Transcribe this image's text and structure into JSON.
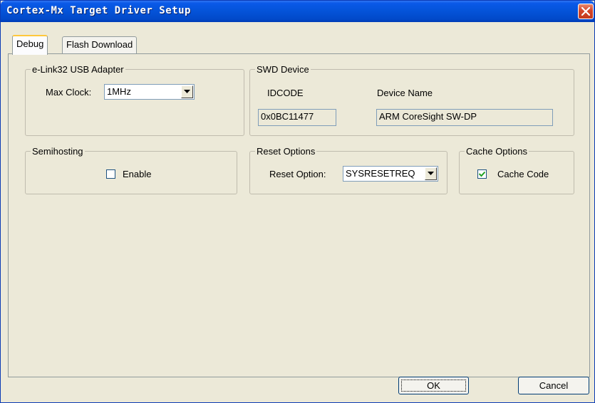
{
  "window": {
    "title": "Cortex-Mx Target Driver Setup"
  },
  "tabs": [
    {
      "label": "Debug",
      "active": true
    },
    {
      "label": "Flash Download",
      "active": false
    }
  ],
  "adapter": {
    "group_label": "e-Link32 USB Adapter",
    "max_clock_label": "Max Clock:",
    "max_clock_value": "1MHz"
  },
  "swd": {
    "group_label": "SWD Device",
    "idcode_header": "IDCODE",
    "device_name_header": "Device Name",
    "idcode_value": "0x0BC11477",
    "device_name_value": "ARM CoreSight SW-DP"
  },
  "semihosting": {
    "group_label": "Semihosting",
    "enable_label": "Enable",
    "enabled": false
  },
  "reset": {
    "group_label": "Reset Options",
    "option_label": "Reset Option:",
    "option_value": "SYSRESETREQ"
  },
  "cache": {
    "group_label": "Cache Options",
    "cache_code_label": "Cache Code",
    "cache_code_checked": true
  },
  "buttons": {
    "ok": "OK",
    "cancel": "Cancel"
  },
  "colors": {
    "titlebar": "#0453d8",
    "dialog_bg": "#ece9d8",
    "close_button": "#d4452a",
    "tab_highlight": "#ffc83c"
  },
  "icons": {
    "close": "close-icon",
    "dropdown": "chevron-down-icon",
    "check": "checkmark-icon"
  }
}
